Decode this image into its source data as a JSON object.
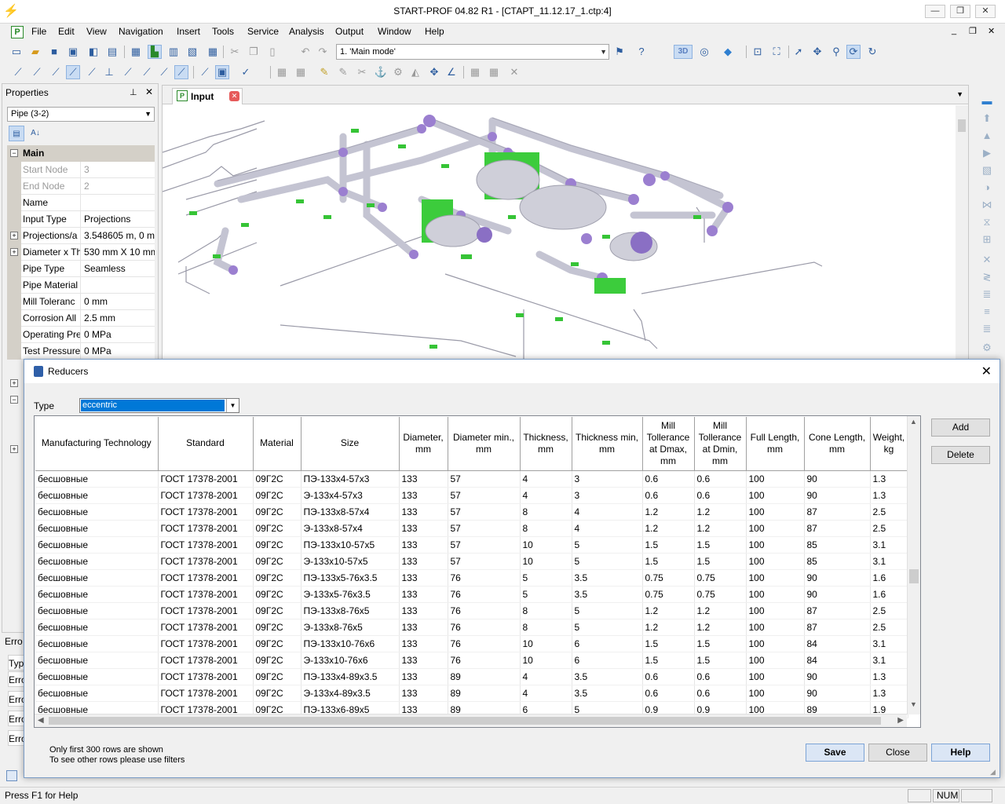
{
  "window": {
    "title": "START-PROF 04.82 R1 - [СТАРТ_11.12.17_1.ctp:4]",
    "minimize_label": "—",
    "maximize_label": "❐",
    "close_label": "✕"
  },
  "menubar": {
    "items": [
      "File",
      "Edit",
      "View",
      "Navigation",
      "Insert",
      "Tools",
      "Service",
      "Analysis",
      "Output",
      "Window",
      "Help"
    ],
    "mdi_minimize": "_",
    "mdi_restore": "❐",
    "mdi_close": "✕"
  },
  "toolbar": {
    "mode_select_value": "1. 'Main mode'",
    "view3d_label": "3D"
  },
  "properties": {
    "title": "Properties",
    "selector_value": "Pipe (3-2)",
    "section_main": "Main",
    "rows": [
      {
        "name": "Start Node",
        "value": "3",
        "disabled": true,
        "expandable": false
      },
      {
        "name": "End Node",
        "value": "2",
        "disabled": true,
        "expandable": false
      },
      {
        "name": "Name",
        "value": "",
        "disabled": false,
        "expandable": false
      },
      {
        "name": "Input Type",
        "value": "Projections",
        "disabled": false,
        "expandable": false
      },
      {
        "name": "Projections/a",
        "value": "3.548605 m, 0 m,",
        "disabled": false,
        "expandable": true
      },
      {
        "name": "Diameter x Th",
        "value": "530 mm X 10 mm",
        "disabled": false,
        "expandable": true
      },
      {
        "name": "Pipe Type",
        "value": "Seamless",
        "disabled": false,
        "expandable": false
      },
      {
        "name": "Pipe Material",
        "value": "",
        "disabled": false,
        "expandable": false
      },
      {
        "name": "Mill Toleranc",
        "value": "0 mm",
        "disabled": false,
        "expandable": false
      },
      {
        "name": "Corrosion All",
        "value": "2.5 mm",
        "disabled": false,
        "expandable": false
      },
      {
        "name": "Operating Pre",
        "value": "0 MPa",
        "disabled": false,
        "expandable": false
      },
      {
        "name": "Test Pressure",
        "value": "0 MPa",
        "disabled": false,
        "expandable": false
      }
    ]
  },
  "errors_panel": {
    "title": "Erro",
    "header": "Typ",
    "rows": [
      "Erro",
      "Erro",
      "Erro",
      "Erro"
    ]
  },
  "document": {
    "tab_label": "Input"
  },
  "statusbar": {
    "text": "Press F1 for Help",
    "num": "NUM"
  },
  "dialog": {
    "title": "Reducers",
    "type_label": "Type",
    "type_value": "eccentric",
    "columns": [
      "Manufacturing Technology",
      "Standard",
      "Material",
      "Size",
      "Diameter, mm",
      "Diameter min., mm",
      "Thickness, mm",
      "Thickness min, mm",
      "Mill Tollerance at Dmax, mm",
      "Mill Tollerance at Dmin, mm",
      "Full Length, mm",
      "Cone Length, mm",
      "Weight, kg"
    ],
    "rows": [
      [
        "бесшовные",
        "ГОСТ 17378-2001",
        "09Г2С",
        "ПЭ-133x4-57x3",
        "133",
        "57",
        "4",
        "3",
        "0.6",
        "0.6",
        "100",
        "90",
        "1.3"
      ],
      [
        "бесшовные",
        "ГОСТ 17378-2001",
        "09Г2С",
        "Э-133x4-57x3",
        "133",
        "57",
        "4",
        "3",
        "0.6",
        "0.6",
        "100",
        "90",
        "1.3"
      ],
      [
        "бесшовные",
        "ГОСТ 17378-2001",
        "09Г2С",
        "ПЭ-133x8-57x4",
        "133",
        "57",
        "8",
        "4",
        "1.2",
        "1.2",
        "100",
        "87",
        "2.5"
      ],
      [
        "бесшовные",
        "ГОСТ 17378-2001",
        "09Г2С",
        "Э-133x8-57x4",
        "133",
        "57",
        "8",
        "4",
        "1.2",
        "1.2",
        "100",
        "87",
        "2.5"
      ],
      [
        "бесшовные",
        "ГОСТ 17378-2001",
        "09Г2С",
        "ПЭ-133x10-57x5",
        "133",
        "57",
        "10",
        "5",
        "1.5",
        "1.5",
        "100",
        "85",
        "3.1"
      ],
      [
        "бесшовные",
        "ГОСТ 17378-2001",
        "09Г2С",
        "Э-133x10-57x5",
        "133",
        "57",
        "10",
        "5",
        "1.5",
        "1.5",
        "100",
        "85",
        "3.1"
      ],
      [
        "бесшовные",
        "ГОСТ 17378-2001",
        "09Г2С",
        "ПЭ-133x5-76x3.5",
        "133",
        "76",
        "5",
        "3.5",
        "0.75",
        "0.75",
        "100",
        "90",
        "1.6"
      ],
      [
        "бесшовные",
        "ГОСТ 17378-2001",
        "09Г2С",
        "Э-133x5-76x3.5",
        "133",
        "76",
        "5",
        "3.5",
        "0.75",
        "0.75",
        "100",
        "90",
        "1.6"
      ],
      [
        "бесшовные",
        "ГОСТ 17378-2001",
        "09Г2С",
        "ПЭ-133x8-76x5",
        "133",
        "76",
        "8",
        "5",
        "1.2",
        "1.2",
        "100",
        "87",
        "2.5"
      ],
      [
        "бесшовные",
        "ГОСТ 17378-2001",
        "09Г2С",
        "Э-133x8-76x5",
        "133",
        "76",
        "8",
        "5",
        "1.2",
        "1.2",
        "100",
        "87",
        "2.5"
      ],
      [
        "бесшовные",
        "ГОСТ 17378-2001",
        "09Г2С",
        "ПЭ-133x10-76x6",
        "133",
        "76",
        "10",
        "6",
        "1.5",
        "1.5",
        "100",
        "84",
        "3.1"
      ],
      [
        "бесшовные",
        "ГОСТ 17378-2001",
        "09Г2С",
        "Э-133x10-76x6",
        "133",
        "76",
        "10",
        "6",
        "1.5",
        "1.5",
        "100",
        "84",
        "3.1"
      ],
      [
        "бесшовные",
        "ГОСТ 17378-2001",
        "09Г2С",
        "ПЭ-133x4-89x3.5",
        "133",
        "89",
        "4",
        "3.5",
        "0.6",
        "0.6",
        "100",
        "90",
        "1.3"
      ],
      [
        "бесшовные",
        "ГОСТ 17378-2001",
        "09Г2С",
        "Э-133x4-89x3.5",
        "133",
        "89",
        "4",
        "3.5",
        "0.6",
        "0.6",
        "100",
        "90",
        "1.3"
      ],
      [
        "бесшовные",
        "ГОСТ 17378-2001",
        "09Г2С",
        "ПЭ-133x6-89x5",
        "133",
        "89",
        "6",
        "5",
        "0.9",
        "0.9",
        "100",
        "89",
        "1.9"
      ]
    ],
    "buttons": {
      "add": "Add",
      "delete": "Delete",
      "save": "Save",
      "close": "Close",
      "help": "Help"
    },
    "note_line1": "Only first 300 rows are shown",
    "note_line2": "To see other rows please use filters"
  },
  "colors": {
    "pipe": "#c8c8d4",
    "fitting": "#9b7fd0",
    "support": "#36c436",
    "selection_blue": "#0078d7"
  }
}
